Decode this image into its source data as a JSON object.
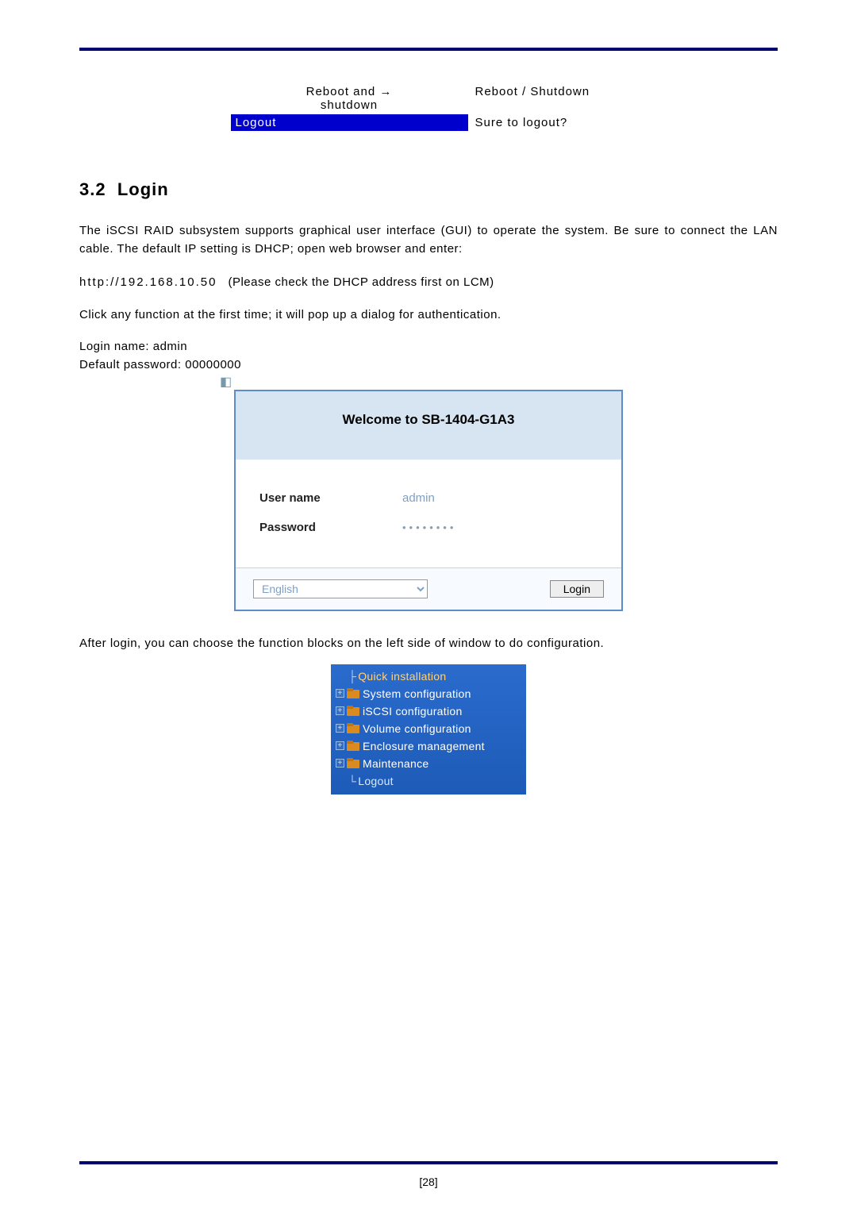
{
  "nav_table": {
    "row1": {
      "left": "Reboot and → shutdown",
      "right": "Reboot / Shutdown"
    },
    "row2": {
      "left": "Logout",
      "right": "Sure to logout?"
    }
  },
  "section": {
    "number": "3.2",
    "title": "Login"
  },
  "paragraphs": {
    "p1": "The iSCSI RAID subsystem supports graphical user interface (GUI) to operate the system. Be sure to connect the LAN cable. The default IP setting is DHCP; open web browser and enter:",
    "url_label": "http://192.168.10.50",
    "url_note": "(Please check the DHCP address first on LCM)",
    "p2": "Click any function at the first time; it will pop up a dialog for authentication.",
    "login_name": "Login name: admin",
    "default_pw": "Default password: 00000000",
    "after_login": "After login, you can choose the function blocks on the left side of window to do configuration."
  },
  "login_panel": {
    "header": "Welcome to SB-1404-G1A3",
    "user_label": "User name",
    "user_value": "admin",
    "pw_label": "Password",
    "pw_value": "••••••••",
    "language": "English",
    "login_btn": "Login"
  },
  "tree": {
    "items": [
      {
        "label": "Quick installation",
        "hasFolder": false,
        "expandable": false,
        "orange": true
      },
      {
        "label": "System configuration",
        "hasFolder": true,
        "expandable": true
      },
      {
        "label": "iSCSI configuration",
        "hasFolder": true,
        "expandable": true
      },
      {
        "label": "Volume configuration",
        "hasFolder": true,
        "expandable": true
      },
      {
        "label": "Enclosure management",
        "hasFolder": true,
        "expandable": true
      },
      {
        "label": "Maintenance",
        "hasFolder": true,
        "expandable": true
      },
      {
        "label": "Logout",
        "hasFolder": false,
        "expandable": false
      }
    ]
  },
  "page_number": "[28]"
}
